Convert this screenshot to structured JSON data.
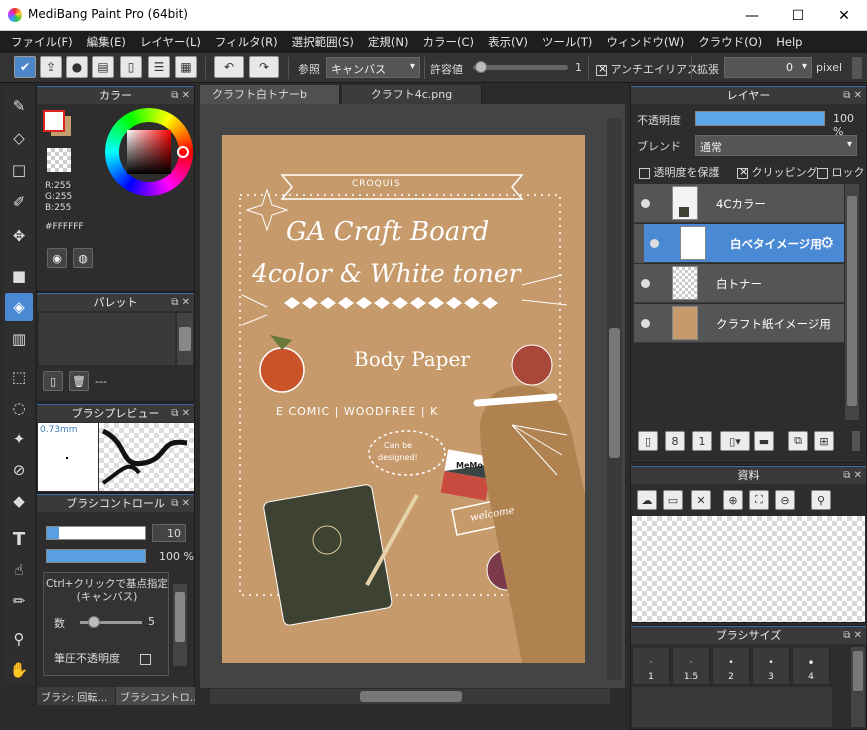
{
  "window": {
    "title": "MediBang Paint Pro (64bit)",
    "minimize": "—",
    "maximize": "☐",
    "close": "✕"
  },
  "menu": [
    "ファイル(F)",
    "編集(E)",
    "レイヤー(L)",
    "フィルタ(R)",
    "選択範囲(S)",
    "定規(N)",
    "カラー(C)",
    "表示(V)",
    "ツール(T)",
    "ウィンドウ(W)",
    "クラウド(O)",
    "Help"
  ],
  "toolbar": {
    "reference_label": "参照",
    "reference_value": "キャンバス",
    "tolerance_label": "許容値",
    "tolerance_value": "1",
    "tolerance_level": 0.02,
    "antialias_label": "アンチエイリアス",
    "expand_label": "拡張",
    "expand_value": "0",
    "expand_unit": "pixel"
  },
  "color_panel": {
    "title": "カラー",
    "r": "R:255",
    "g": "G:255",
    "b": "B:255",
    "hex": "#FFFFFF",
    "fg": "#ffffff",
    "bg": "#c4a070"
  },
  "palette_panel": {
    "title": "パレット",
    "value": "---"
  },
  "brush_preview": {
    "title": "ブラシプレビュー",
    "size": "0.73mm"
  },
  "brush_control": {
    "title": "ブラシコントロール",
    "size_value": "10",
    "size_level": 0.12,
    "opacity_value": "100 %",
    "opacity_level": 1.0,
    "hint_line1": "Ctrl+クリックで基点指定",
    "hint_line2": "(キャンバス)",
    "count_label": "数",
    "count_value": "5",
    "pressure_label": "筆圧不透明度",
    "tab1": "ブラシ: 回転…",
    "tab2": "ブラシコントロ…"
  },
  "tabs": [
    "クラフト白トナーb用.psd",
    "クラフト4c.png"
  ],
  "artwork": {
    "croquis": "CROQUIS",
    "title1": "GA Craft Board",
    "title2": "4color & White toner",
    "body_paper": "Body Paper",
    "brands": "E COMIC | WOODFREE | K",
    "bubble1": "Can be",
    "bubble2": "designed!",
    "memo": "MeMo",
    "welcome": "welcome"
  },
  "layer_panel": {
    "title": "レイヤー",
    "opacity_label": "不透明度",
    "opacity_value": "100 %",
    "opacity_level": 1.0,
    "blend_label": "ブレンド",
    "blend_value": "通常",
    "protect_label": "透明度を保護",
    "clipping_label": "クリッピング",
    "lock_label": "ロック",
    "layers": [
      {
        "name": "4Cカラー"
      },
      {
        "name": "白ベタイメージ用"
      },
      {
        "name": "白トナー"
      },
      {
        "name": "クラフト紙イメージ用"
      }
    ]
  },
  "materials_panel": {
    "title": "資料"
  },
  "brush_size_panel": {
    "title": "ブラシサイズ",
    "sizes": [
      "1",
      "1.5",
      "2",
      "3",
      "4"
    ]
  }
}
